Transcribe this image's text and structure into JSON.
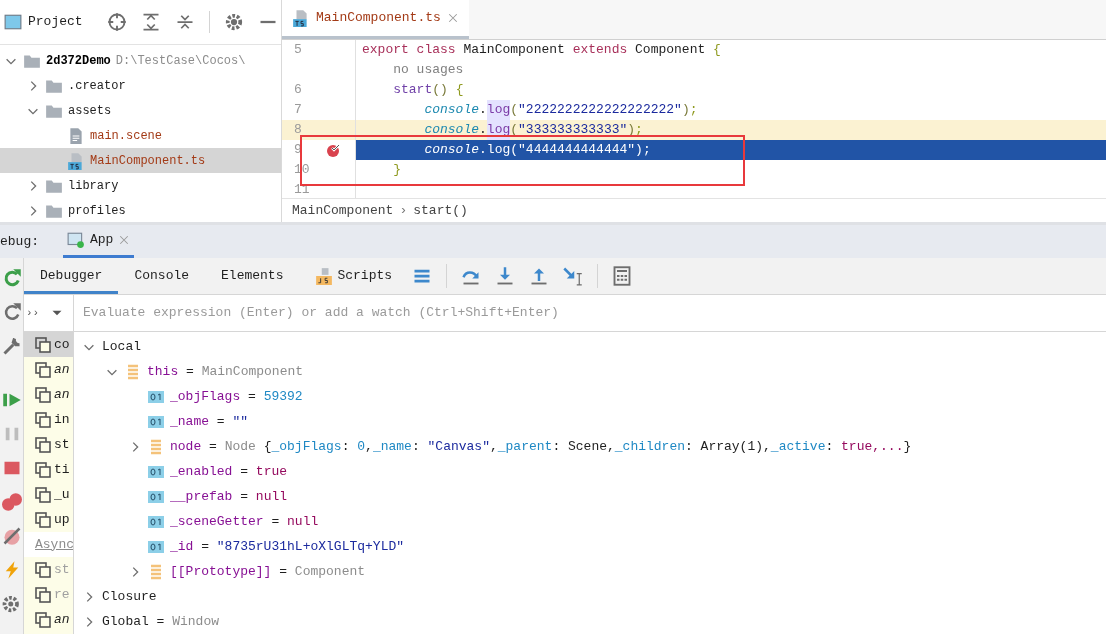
{
  "project": {
    "title": "Project",
    "tree": [
      {
        "kind": "folder",
        "name": "2d372Demo",
        "hint": "D:\\TestCase\\Cocos\\",
        "bold": true,
        "expanded": true,
        "selected": false,
        "children": [
          {
            "kind": "folder",
            "name": ".creator",
            "bold": false,
            "expanded": false,
            "selected": false
          },
          {
            "kind": "folder",
            "name": "assets",
            "bold": false,
            "expanded": true,
            "selected": false,
            "children": [
              {
                "kind": "scene",
                "name": "main.scene",
                "bold": false,
                "selected": false
              },
              {
                "kind": "ts",
                "name": "MainComponent.ts",
                "bold": false,
                "selected": true
              }
            ]
          },
          {
            "kind": "folder",
            "name": "library",
            "bold": false,
            "expanded": false,
            "selected": false
          },
          {
            "kind": "folder",
            "name": "profiles",
            "bold": false,
            "expanded": false,
            "selected": false
          }
        ]
      }
    ]
  },
  "editor": {
    "tabs": [
      {
        "label": "MainComponent.ts",
        "selected": true
      }
    ],
    "lines": [
      {
        "number": "5",
        "caret_line": false,
        "execution_line": false,
        "breakpoint": false,
        "tokens": [
          {
            "kind": "keyword",
            "t": "export class "
          },
          {
            "kind": "plain",
            "t": "MainComponent "
          },
          {
            "kind": "keyword",
            "t": "extends "
          },
          {
            "kind": "plain",
            "t": "Component "
          },
          {
            "kind": "brace",
            "t": "{"
          }
        ]
      },
      {
        "caret_line": false,
        "execution_line": false,
        "breakpoint": false,
        "tokens": [
          {
            "kind": "hint",
            "t": "    no usages"
          }
        ]
      },
      {
        "number": "6",
        "caret_line": false,
        "execution_line": false,
        "breakpoint": false,
        "tokens": [
          {
            "kind": "method",
            "t": "    start"
          },
          {
            "kind": "paren",
            "t": "() "
          },
          {
            "kind": "brace",
            "t": "{"
          }
        ]
      },
      {
        "number": "7",
        "caret_line": false,
        "execution_line": false,
        "breakpoint": false,
        "tokens": [
          {
            "kind": "object",
            "t": "        console"
          },
          {
            "kind": "plain",
            "t": "."
          },
          {
            "kind": "call",
            "t": "log",
            "mark": true
          },
          {
            "kind": "paren",
            "t": "("
          },
          {
            "kind": "string",
            "t": "\"2222222222222222222\""
          },
          {
            "kind": "paren",
            "t": ")"
          },
          {
            "kind": "semi",
            "t": ";"
          }
        ]
      },
      {
        "number": "8",
        "caret_line": true,
        "execution_line": false,
        "breakpoint": false,
        "tokens": [
          {
            "kind": "object",
            "t": "        console"
          },
          {
            "kind": "plain",
            "t": "."
          },
          {
            "kind": "call",
            "t": "log",
            "mark": true
          },
          {
            "kind": "paren",
            "t": "("
          },
          {
            "kind": "string",
            "t": "\"333333333333\""
          },
          {
            "kind": "paren",
            "t": ")"
          },
          {
            "kind": "semi",
            "t": ";"
          }
        ]
      },
      {
        "number": "9",
        "caret_line": false,
        "execution_line": true,
        "breakpoint": true,
        "tokens": [
          {
            "kind": "object",
            "t": "        console"
          },
          {
            "kind": "plain",
            "t": "."
          },
          {
            "kind": "call",
            "t": "log",
            "mark": false
          },
          {
            "kind": "paren",
            "t": "("
          },
          {
            "kind": "string",
            "t": "\"4444444444444\""
          },
          {
            "kind": "paren",
            "t": ")"
          },
          {
            "kind": "semi",
            "t": ";"
          }
        ]
      },
      {
        "number": "10",
        "caret_line": false,
        "execution_line": false,
        "breakpoint": false,
        "tokens": [
          {
            "kind": "brace",
            "t": "    }"
          }
        ]
      },
      {
        "number": "11",
        "caret_line": false,
        "execution_line": false,
        "breakpoint": false
      }
    ],
    "breadcrumb": [
      "MainComponent",
      "start()"
    ],
    "breadcrumb_separator": "›"
  },
  "debug": {
    "label": "ebug:",
    "session": {
      "label": "App",
      "selected": true
    },
    "tabs": [
      {
        "kind": "plain",
        "label": "Debugger",
        "selected": true
      },
      {
        "kind": "plain",
        "label": "Console",
        "selected": false
      },
      {
        "kind": "plain",
        "label": "Elements",
        "selected": false
      },
      {
        "kind": "script",
        "label": "Scripts",
        "selected": false
      }
    ],
    "expression_placeholder": "Evaluate expression (Enter) or add a watch (Ctrl+Shift+Enter)",
    "expand_glyph": "››",
    "frames": [
      {
        "kind": "frame",
        "label": "co",
        "italic": false,
        "dimmed": false,
        "selected": true
      },
      {
        "kind": "frame",
        "label": "an",
        "italic": true,
        "dimmed": false,
        "selected": false
      },
      {
        "kind": "frame",
        "label": "an",
        "italic": true,
        "dimmed": false,
        "selected": false
      },
      {
        "kind": "frame",
        "label": "in",
        "italic": false,
        "dimmed": false,
        "selected": false
      },
      {
        "kind": "frame",
        "label": "st",
        "italic": false,
        "dimmed": false,
        "selected": false
      },
      {
        "kind": "frame",
        "label": "ti",
        "italic": false,
        "dimmed": false,
        "selected": false
      },
      {
        "kind": "frame",
        "label": "_u",
        "italic": false,
        "dimmed": false,
        "selected": false
      },
      {
        "kind": "frame",
        "label": "up",
        "italic": false,
        "dimmed": false,
        "selected": false
      },
      {
        "kind": "header",
        "label": "Async"
      },
      {
        "kind": "frame",
        "label": "st",
        "italic": false,
        "dimmed": true,
        "selected": false
      },
      {
        "kind": "frame",
        "label": "re",
        "italic": false,
        "dimmed": true,
        "selected": false
      },
      {
        "kind": "frame",
        "label": "an",
        "italic": true,
        "dimmed": false,
        "selected": false
      }
    ],
    "variables": [
      {
        "kind": "scope",
        "name": "Local",
        "expanded": true,
        "children": [
          {
            "kind": "object",
            "name": "this",
            "expanded": true,
            "value": [
              {
                "kind": "type",
                "t": "MainComponent"
              }
            ],
            "children": [
              {
                "kind": "primitive",
                "name": "_objFlags",
                "value": [
                  {
                    "kind": "number",
                    "t": "59392"
                  }
                ]
              },
              {
                "kind": "primitive",
                "name": "_name",
                "value": [
                  {
                    "kind": "string",
                    "t": "\"\""
                  }
                ]
              },
              {
                "kind": "object",
                "name": "node",
                "expanded": false,
                "value": [
                  {
                    "kind": "type",
                    "t": "Node "
                  },
                  {
                    "kind": "plain",
                    "t": "{"
                  },
                  {
                    "kind": "field",
                    "t": "_objFlags"
                  },
                  {
                    "kind": "plain",
                    "t": ": "
                  },
                  {
                    "kind": "number",
                    "t": "0"
                  },
                  {
                    "kind": "plain",
                    "t": ","
                  },
                  {
                    "kind": "field",
                    "t": "_name"
                  },
                  {
                    "kind": "plain",
                    "t": ": "
                  },
                  {
                    "kind": "string",
                    "t": "\"Canvas\""
                  },
                  {
                    "kind": "plain",
                    "t": ","
                  },
                  {
                    "kind": "field",
                    "t": "_parent"
                  },
                  {
                    "kind": "plain",
                    "t": ": Scene,"
                  },
                  {
                    "kind": "field",
                    "t": "_children"
                  },
                  {
                    "kind": "plain",
                    "t": ": Array(1),"
                  },
                  {
                    "kind": "field",
                    "t": "_active"
                  },
                  {
                    "kind": "plain",
                    "t": ": "
                  },
                  {
                    "kind": "keyword",
                    "t": "true,..."
                  },
                  {
                    "kind": "plain",
                    "t": "}"
                  }
                ]
              },
              {
                "kind": "primitive",
                "name": "_enabled",
                "value": [
                  {
                    "kind": "keyword",
                    "t": "true"
                  }
                ]
              },
              {
                "kind": "primitive",
                "name": "__prefab",
                "value": [
                  {
                    "kind": "keyword",
                    "t": "null"
                  }
                ]
              },
              {
                "kind": "primitive",
                "name": "_sceneGetter",
                "value": [
                  {
                    "kind": "keyword",
                    "t": "null"
                  }
                ]
              },
              {
                "kind": "primitive",
                "name": "_id",
                "value": [
                  {
                    "kind": "string",
                    "t": "\"8735rU31hL+oXlGLTq+YLD\""
                  }
                ]
              },
              {
                "kind": "object",
                "name": "[[Prototype]]",
                "expanded": false,
                "value": [
                  {
                    "kind": "type",
                    "t": "Component"
                  }
                ]
              }
            ]
          }
        ]
      },
      {
        "kind": "scope",
        "name": "Closure",
        "expanded": false
      },
      {
        "kind": "scope",
        "name": "Global",
        "expanded": false,
        "value": [
          {
            "kind": "type",
            "t": "Window"
          }
        ]
      }
    ],
    "assign": "="
  }
}
